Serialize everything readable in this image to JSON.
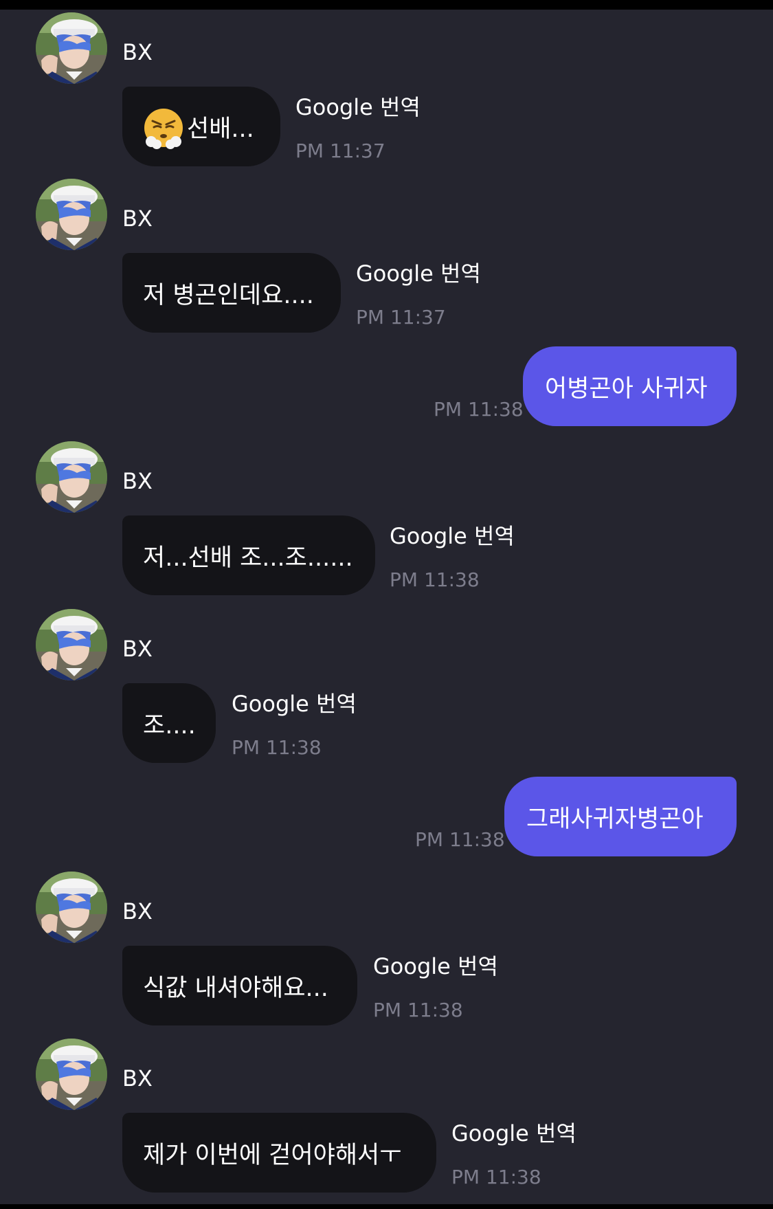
{
  "chat": {
    "messages": [
      {
        "kind": "in",
        "sender": "BX",
        "text": "선배...",
        "emoji": "steam-from-nose-emoji",
        "translate_label": "Google 번역",
        "time": "PM 11:37"
      },
      {
        "kind": "in",
        "sender": "BX",
        "text": "저 병곤인데요....",
        "translate_label": "Google 번역",
        "time": "PM 11:37"
      },
      {
        "kind": "out",
        "text": "어병곤아 사귀자",
        "time": "PM 11:38"
      },
      {
        "kind": "in",
        "sender": "BX",
        "text": "저...선배 조...조......",
        "translate_label": "Google 번역",
        "time": "PM 11:38"
      },
      {
        "kind": "in",
        "sender": "BX",
        "text": "조....",
        "translate_label": "Google 번역",
        "time": "PM 11:38"
      },
      {
        "kind": "out",
        "text": "그래사귀자병곤아",
        "time": "PM 11:38"
      },
      {
        "kind": "in",
        "sender": "BX",
        "text": "식값 내셔야해요...",
        "translate_label": "Google 번역",
        "time": "PM 11:38"
      },
      {
        "kind": "in",
        "sender": "BX",
        "text": "제가 이번에 걷어야해서ㅜ",
        "translate_label": "Google 번역",
        "time": "PM 11:38"
      }
    ]
  },
  "colors": {
    "background": "#25252f",
    "incoming_bubble": "#141418",
    "outgoing_bubble": "#5b56e8",
    "timestamp": "#7d7d8c"
  }
}
